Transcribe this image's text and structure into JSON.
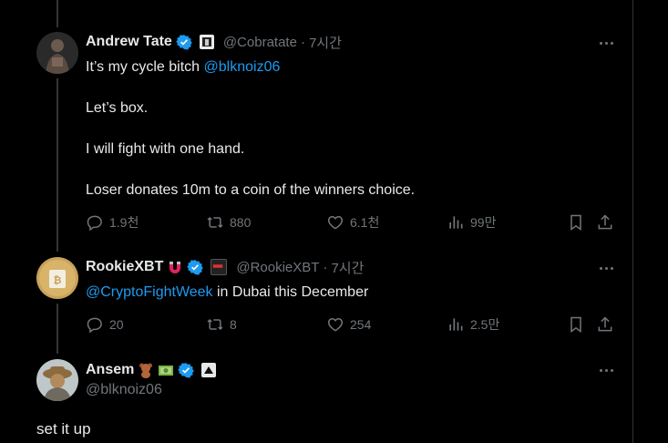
{
  "tweets": [
    {
      "name": "Andrew Tate",
      "handle": "@Cobratate",
      "time": "7시간",
      "lines": [
        "It’s my cycle bitch ",
        "Let’s box.",
        "I will fight with one hand.",
        "Loser donates 10m to a coin of the winners choice."
      ],
      "mention": "@blknoiz06",
      "replies": "1.9천",
      "retweets": "880",
      "likes": "6.1천",
      "views": "99만"
    },
    {
      "name": "RookieXBT",
      "handle": "@RookieXBT",
      "time": "7시간",
      "mention": "@CryptoFightWeek",
      "text_rest": " in Dubai this December",
      "replies": "20",
      "retweets": "8",
      "likes": "254",
      "views": "2.5만"
    },
    {
      "name": "Ansem",
      "handle": "@blknoiz06",
      "text": "set it up"
    }
  ],
  "colors": {
    "accent": "#1d9bf0",
    "muted": "#71767b",
    "text": "#e7e9ea",
    "bg": "#000000"
  },
  "icons": [
    "reply-icon",
    "retweet-icon",
    "like-icon",
    "views-icon",
    "bookmark-icon",
    "share-icon",
    "verified-icon",
    "more-icon"
  ]
}
